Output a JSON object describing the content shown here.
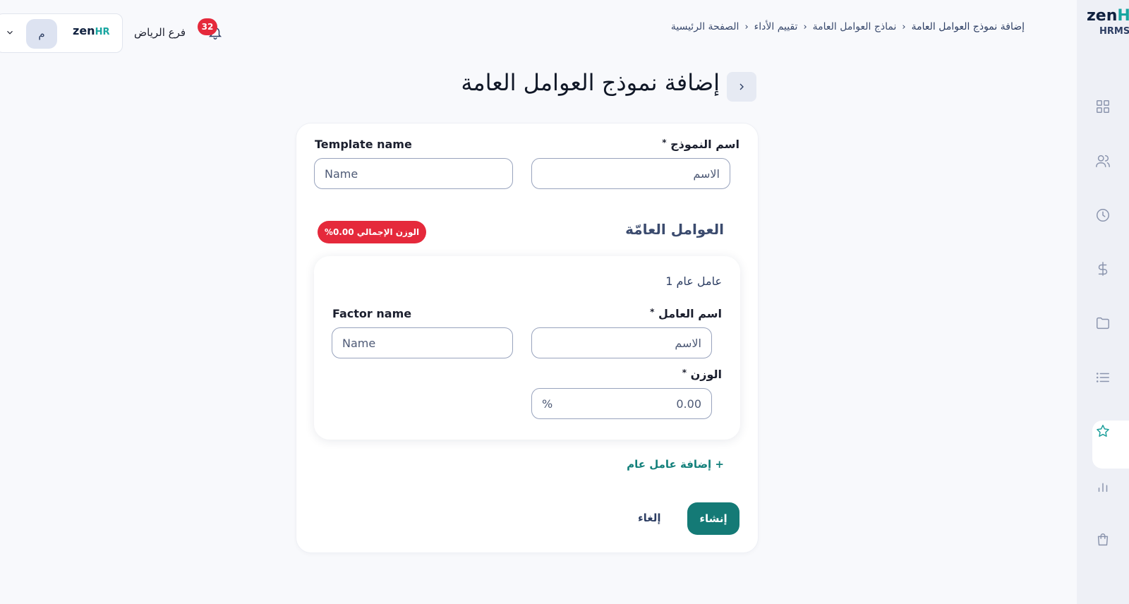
{
  "sidebar": {
    "logo_zen": "zen",
    "logo_hr": "HR",
    "logo_sub": "HRMS",
    "items": [
      {
        "icon": "dashboard-grid-icon"
      },
      {
        "icon": "users-icon"
      },
      {
        "icon": "clock-icon"
      },
      {
        "icon": "dollar-icon"
      },
      {
        "icon": "folder-icon"
      },
      {
        "icon": "list-icon"
      },
      {
        "icon": "star-icon",
        "active": true
      },
      {
        "icon": "bar-chart-icon"
      },
      {
        "icon": "shopping-bag-icon"
      }
    ]
  },
  "header": {
    "breadcrumb": {
      "home": "الصفحة الرئيسية",
      "performance": "تقييم الأداء",
      "templates": "نماذج العوامل العامة",
      "current": "إضافة نموذج العوامل العامة"
    },
    "notifications_count": "32",
    "branch": "فرع الرياض",
    "company_logo_zen": "zen",
    "company_logo_hr": "HR",
    "avatar_initial": "م"
  },
  "page": {
    "title": "إضافة نموذج العوامل العامة"
  },
  "form": {
    "template_name_ar_label": "اسم النموذج",
    "template_name_ar_placeholder": "الاسم",
    "template_name_en_label": "Template name",
    "template_name_en_placeholder": "Name",
    "required_mark": "*",
    "section_title": "العوامل العامّة",
    "total_weight_badge": "الوزن الإجمالي 0.00%",
    "factors": [
      {
        "title": "عامل عام 1",
        "name_ar_label": "اسم العامل",
        "name_ar_placeholder": "الاسم",
        "name_en_label": "Factor name",
        "name_en_placeholder": "Name",
        "weight_label": "الوزن",
        "weight_value": "0.00",
        "weight_unit": "%"
      }
    ],
    "add_factor_label": "+ إضافة عامل عام",
    "create_label": "إنشاء",
    "cancel_label": "إلغاء"
  },
  "colors": {
    "accent": "#147a76",
    "badge_red": "#e5293b",
    "sidebar_bg": "#eef0f6"
  }
}
